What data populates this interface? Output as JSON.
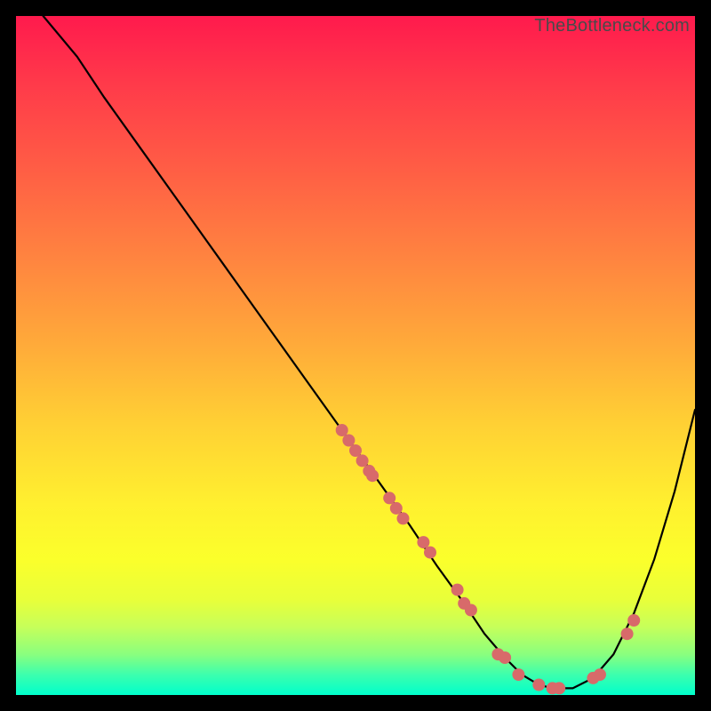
{
  "watermark": "TheBottleneck.com",
  "chart_data": {
    "type": "line",
    "title": "",
    "xlabel": "",
    "ylabel": "",
    "xlim": [
      0,
      100
    ],
    "ylim": [
      0,
      100
    ],
    "curve": {
      "name": "bottleneck-curve",
      "x": [
        4,
        9,
        13,
        18,
        23,
        28,
        33,
        38,
        43,
        48,
        53,
        58,
        62,
        66,
        69,
        72,
        74.5,
        77,
        79,
        82,
        85,
        88,
        91,
        94,
        97,
        100
      ],
      "y": [
        100,
        94,
        88,
        81,
        74,
        67,
        60,
        53,
        46,
        39,
        32,
        25,
        19,
        13.5,
        9,
        5.5,
        3,
        1.5,
        1,
        1,
        2.5,
        6,
        12,
        20,
        30,
        42
      ]
    },
    "points": {
      "name": "data-points",
      "x": [
        48,
        49,
        50,
        51,
        52,
        52.5,
        55,
        56,
        57,
        60,
        61,
        65,
        66,
        67,
        71,
        72,
        74,
        77,
        79,
        80,
        85,
        86,
        90,
        91
      ],
      "y": [
        39,
        37.5,
        36,
        34.5,
        33,
        32.3,
        29,
        27.5,
        26,
        22.5,
        21,
        15.5,
        13.5,
        12.5,
        6,
        5.5,
        3,
        1.5,
        1,
        1,
        2.5,
        3,
        9,
        11
      ]
    },
    "gradient_stops": [
      {
        "pos": 0,
        "color": "#ff1a4d"
      },
      {
        "pos": 50,
        "color": "#ffb438"
      },
      {
        "pos": 80,
        "color": "#fbff2b"
      },
      {
        "pos": 100,
        "color": "#00ffcc"
      }
    ]
  }
}
